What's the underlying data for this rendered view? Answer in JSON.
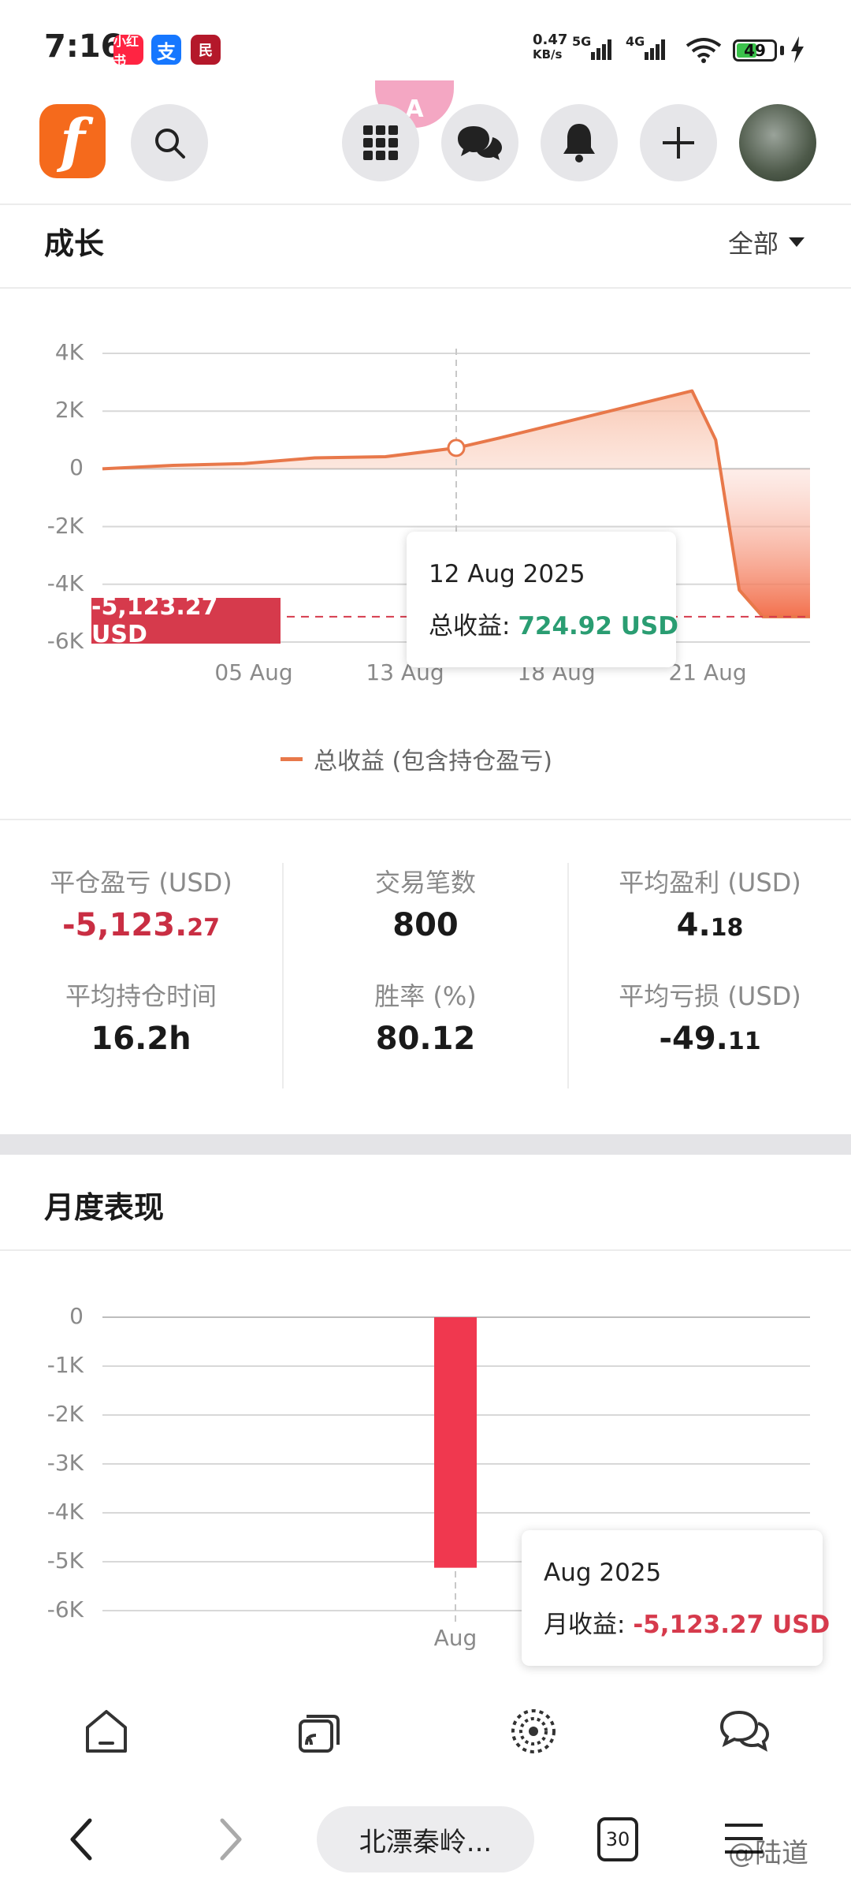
{
  "status_bar": {
    "time": "7:16",
    "apps": [
      "小红书",
      "支",
      "民"
    ],
    "net_speed": "0.47",
    "net_unit": "KB/s",
    "sig1_label": "5G",
    "sig2_label": "4G",
    "battery": "49"
  },
  "app_bar": {
    "logo_letter": "f",
    "translate_badge": "A"
  },
  "growth": {
    "title": "成长",
    "filter_label": "全部",
    "legend": "总收益 (包含持仓盈亏)",
    "current_value_badge": "-5,123.27 USD",
    "tooltip": {
      "date": "12 Aug 2025",
      "label": "总收益:",
      "value": "724.92 USD"
    }
  },
  "chart_data": [
    {
      "type": "area",
      "y_ticks": [
        "4K",
        "2K",
        "0",
        "-2K",
        "-4K",
        "-6K"
      ],
      "x_ticks": [
        "05 Aug",
        "13 Aug",
        "18 Aug",
        "21 Aug"
      ],
      "ylim": [
        -6000,
        4000
      ],
      "series": [
        {
          "name": "总收益 (包含持仓盈亏)",
          "color": "#e8784a",
          "points": [
            {
              "x": "28 Jul",
              "y": 0
            },
            {
              "x": "31 Jul",
              "y": 120
            },
            {
              "x": "03 Aug",
              "y": 180
            },
            {
              "x": "06 Aug",
              "y": 380
            },
            {
              "x": "09 Aug",
              "y": 420
            },
            {
              "x": "12 Aug",
              "y": 724.92
            },
            {
              "x": "14 Aug",
              "y": 1100
            },
            {
              "x": "17 Aug",
              "y": 1700
            },
            {
              "x": "20 Aug",
              "y": 2300
            },
            {
              "x": "22 Aug",
              "y": 2700
            },
            {
              "x": "23 Aug",
              "y": 1000
            },
            {
              "x": "24 Aug",
              "y": -4200
            },
            {
              "x": "25 Aug",
              "y": -5123.27
            },
            {
              "x": "27 Aug",
              "y": -5123.27
            }
          ]
        }
      ],
      "highlight_point": {
        "x": "12 Aug",
        "y": 724.92
      },
      "reference_line": -5123.27
    },
    {
      "type": "bar",
      "y_ticks": [
        "0",
        "-1K",
        "-2K",
        "-3K",
        "-4K",
        "-5K",
        "-6K"
      ],
      "ylim": [
        -6000,
        0
      ],
      "categories": [
        "Aug"
      ],
      "series": [
        {
          "name": "月收益",
          "values": [
            -5123.27
          ],
          "color": "#f0384f"
        }
      ]
    }
  ],
  "stats": [
    {
      "label": "平仓盈亏 (USD)",
      "value_main": "-5,123.",
      "value_dec": "27",
      "red": true
    },
    {
      "label": "交易笔数",
      "value_main": "800",
      "value_dec": "",
      "red": false
    },
    {
      "label": "平均盈利 (USD)",
      "value_main": "4.",
      "value_dec": "18",
      "red": false
    },
    {
      "label": "平均持仓时间",
      "value_main": "16.2h",
      "value_dec": "",
      "red": false
    },
    {
      "label": "胜率 (%)",
      "value_main": "80.12",
      "value_dec": "",
      "red": false
    },
    {
      "label": "平均亏损 (USD)",
      "value_main": "-49.",
      "value_dec": "11",
      "red": false
    }
  ],
  "monthly": {
    "title": "月度表现",
    "tooltip": {
      "date": "Aug 2025",
      "label": "月收益:",
      "value": "-5,123.27 USD"
    }
  },
  "browser": {
    "url_text": "北漂秦岭...",
    "tab_count": "30",
    "watermark": "@陆道"
  }
}
